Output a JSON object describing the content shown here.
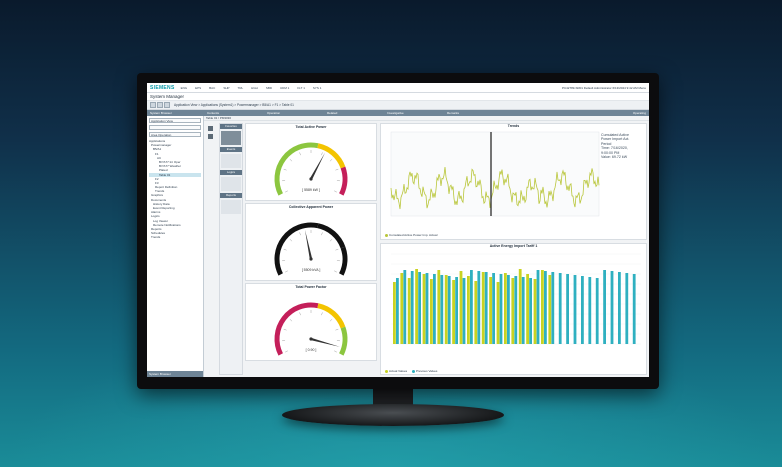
{
  "app": {
    "brand": "SIEMENS",
    "title": "System Manager",
    "top_items": [
      "ENG",
      "EPS",
      "BAC",
      "SHP",
      "TRL",
      "HGH",
      "SBD",
      "UDM 1",
      "FLT 1",
      "SYS 1"
    ],
    "user_info": "PC42789-SR01 Default Administrator 6/13/2024 9:42 AM Menu"
  },
  "breadcrumb": "Application View > Applications (System1) > Powermanager > B5/A1 > F1 > Table 01",
  "column_heads": [
    "System Browser",
    "Contents",
    "Operation",
    "Related",
    "Investigative",
    "Remarks",
    "Operating"
  ],
  "left_pane": {
    "view_select": "Application View",
    "search_placeholder": "",
    "filter_select": "Area Operation",
    "tree": [
      "Applications",
      "Powermanager",
      "B5/A1",
      "F1",
      "AC",
      "B7/A77 Int Oper",
      "B7/A77 Weather",
      "Plated",
      "Table 01",
      "F2",
      "F3",
      "Report Definition",
      "Trends",
      "Graphics",
      "Documents",
      "History Data",
      "Event Reporting",
      "Alarms",
      "Logics",
      "Log Viewer",
      "Remote Notifications",
      "Reports",
      "Schedules",
      "Trends"
    ],
    "highlight_index": 8,
    "footer": "System Browser"
  },
  "main": {
    "header": "Table 01 / PM3030",
    "palette": {
      "sections": [
        "Favorites",
        "Events",
        "Logics",
        "Reports"
      ]
    }
  },
  "gauges": [
    {
      "title": "Total Active Power",
      "value_text": "[ 5589 kW ]",
      "fraction": 0.62
    },
    {
      "title": "Collective Apparent Power",
      "value_text": "[ 5509 kVA ]",
      "fraction": 0.45
    },
    {
      "title": "Total Power Factor",
      "value_text": "[ 0.90 ]",
      "fraction": 0.95
    }
  ],
  "trend": {
    "title": "Trends",
    "info": [
      "Cumulated Active",
      "Power Import Act.",
      "Period",
      "Time: 7/16/2020,",
      "9:00:00 PM",
      "Value: 69.72 kW"
    ],
    "legend": "Cumulated Active Power Imp. Actual",
    "color": "#b9c63a",
    "cursor_color": "#3a3a3a"
  },
  "bars_chart": {
    "title": "Active Energy Import Tariff 1",
    "legend": [
      "Actual Values",
      "Previous Values"
    ],
    "colors": [
      "#c9d321",
      "#2fb0c0"
    ]
  },
  "colors": {
    "gauge_green": "#8cc63f",
    "gauge_yellow": "#f3c400",
    "gauge_red": "#c41f5a",
    "accent": "#0a9aa8"
  }
}
